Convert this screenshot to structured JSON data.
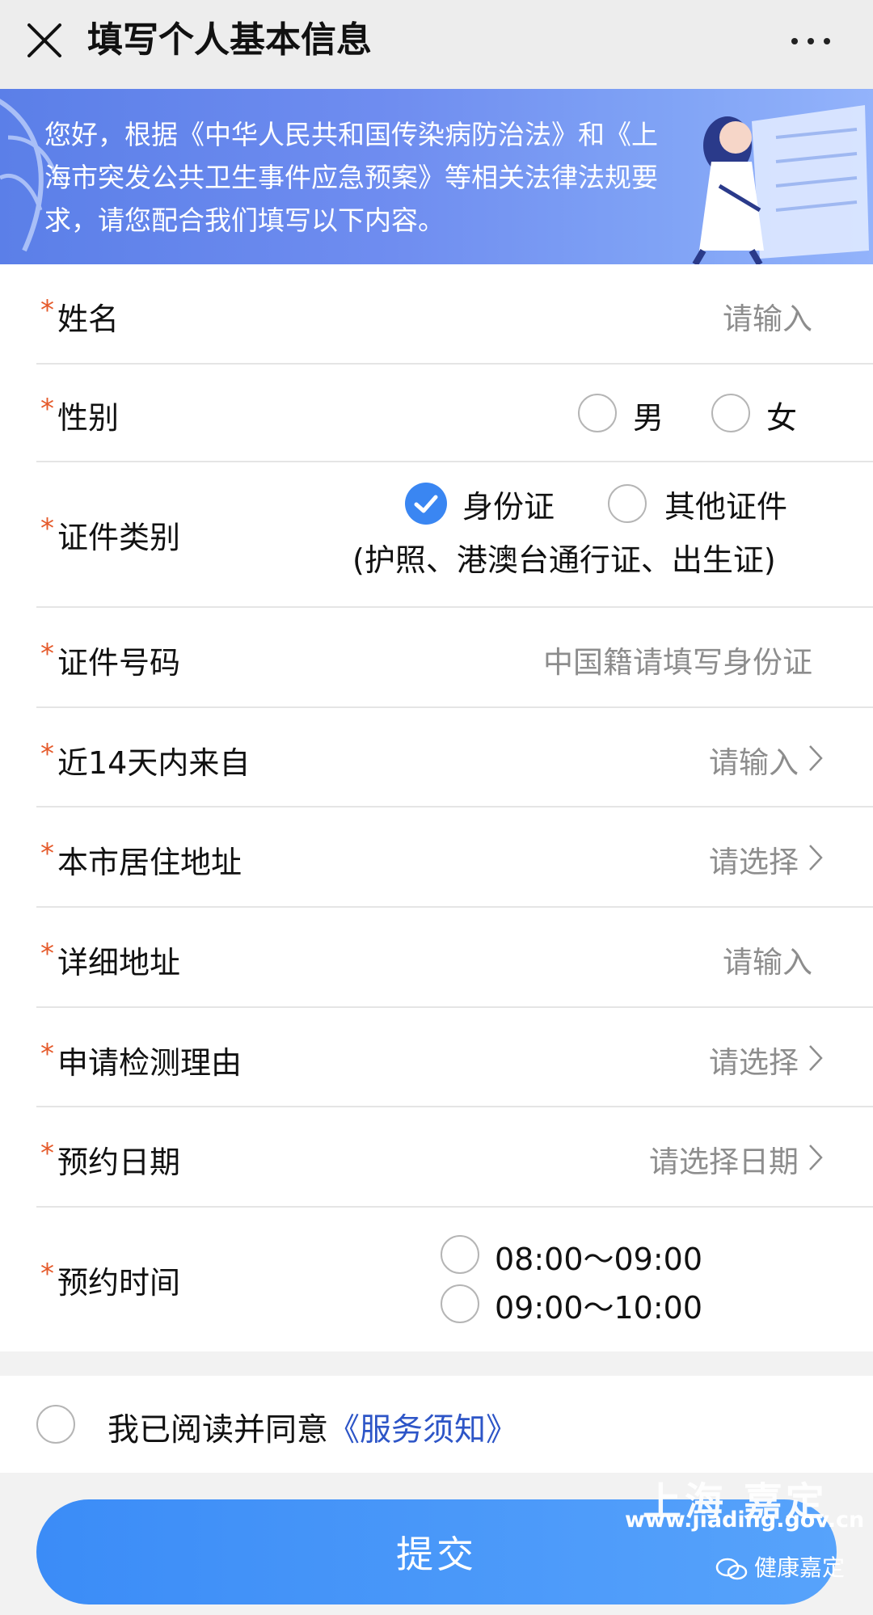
{
  "header": {
    "title": "填写个人基本信息"
  },
  "banner": {
    "text": "您好，根据《中华人民共和国传染病防治法》和《上海市突发公共卫生事件应急预案》等相关法律法规要求，请您配合我们填写以下内容。"
  },
  "form": {
    "required_mark": "*",
    "name": {
      "label": "姓名",
      "placeholder": "请输入"
    },
    "gender": {
      "label": "性别",
      "male": "男",
      "female": "女"
    },
    "id_type": {
      "label": "证件类别",
      "opt1": "身份证",
      "opt2": "其他证件",
      "opt2_note": "(护照、港澳台通行证、出生证)"
    },
    "id_number": {
      "label": "证件号码",
      "placeholder": "中国籍请填写身份证"
    },
    "from14": {
      "label": "近14天内来自",
      "placeholder": "请输入"
    },
    "address": {
      "label": "本市居住地址",
      "placeholder": "请选择"
    },
    "detail": {
      "label": "详细地址",
      "placeholder": "请输入"
    },
    "reason": {
      "label": "申请检测理由",
      "placeholder": "请选择"
    },
    "date": {
      "label": "预约日期",
      "placeholder": "请选择日期"
    },
    "time": {
      "label": "预约时间",
      "slot1": "08:00～09:00",
      "slot2": "09:00～10:00"
    }
  },
  "agreement": {
    "prefix": "我已阅读并同意",
    "link": "《服务须知》"
  },
  "submit": {
    "label": "提交"
  },
  "watermark": {
    "city": "上海 嘉定",
    "url": "www.jiading.gov.cn",
    "account": "健康嘉定"
  },
  "colors": {
    "accent": "#3a86f2",
    "required": "#e55a2b",
    "link": "#2d55c7"
  }
}
